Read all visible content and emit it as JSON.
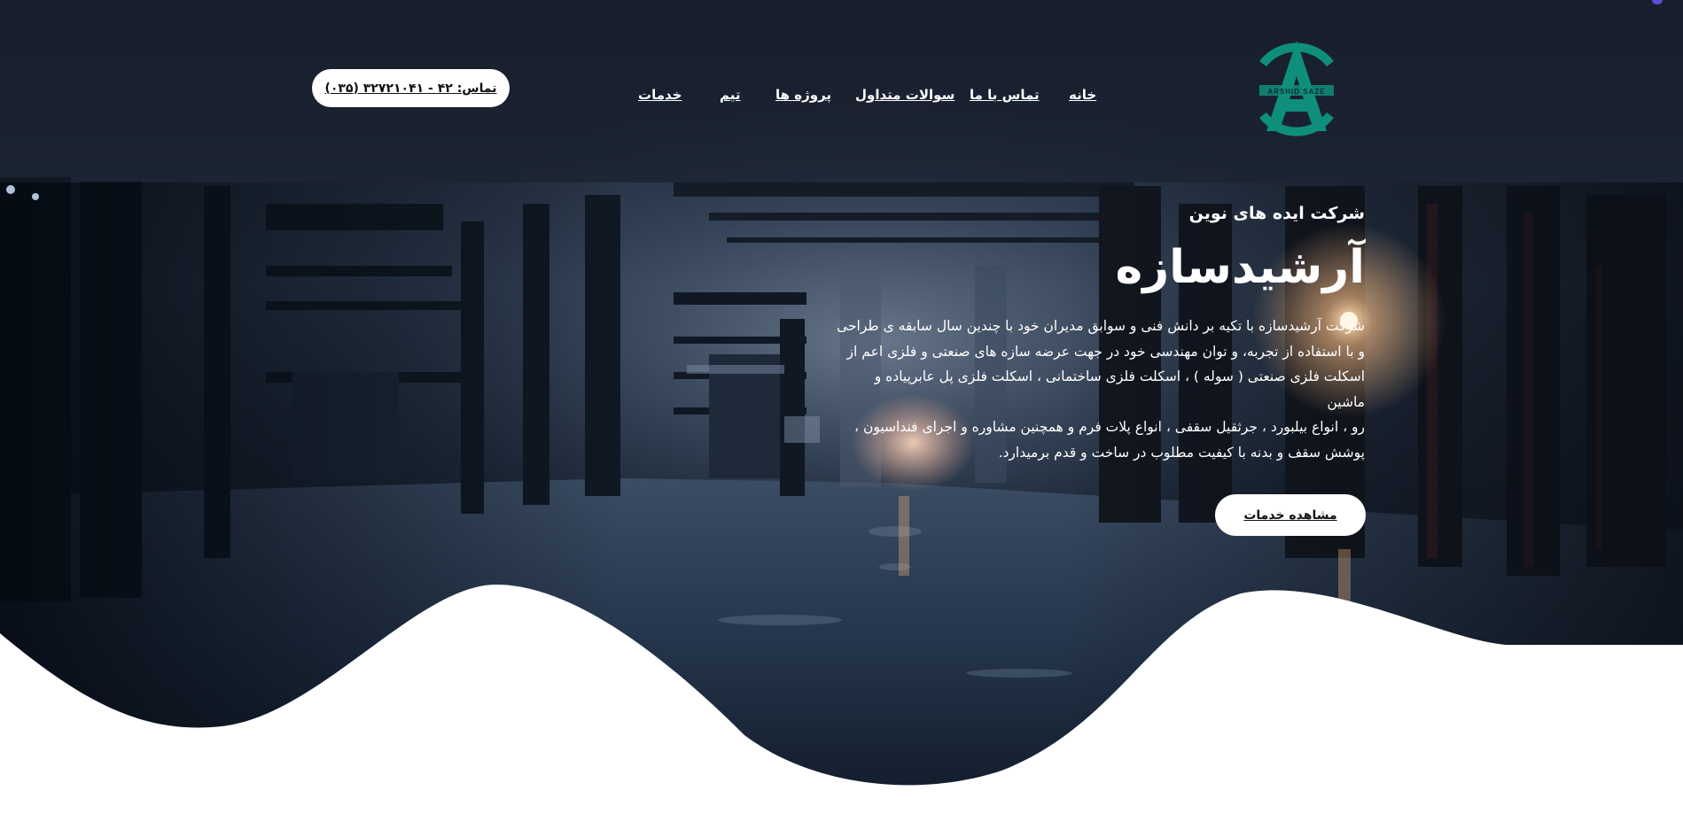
{
  "colors": {
    "brand_teal": "#0f8f7b",
    "header_overlay": "rgba(20,26,38,0.55)",
    "scene_dark": "#0c1624",
    "light_glow": "#f0b882",
    "pill_background": "#ffffff",
    "text_white": "#ffffff"
  },
  "header": {
    "logo": {
      "letters": "AS",
      "text": "ARSHID SAZE",
      "icon": "company-logo-icon"
    },
    "nav": {
      "home": "خانه",
      "contact": "تماس با ما",
      "faq": "سوالات متداول",
      "projects": "پروژه ها",
      "team": "تیم",
      "services": "خدمات"
    },
    "contact_pill": "تماس: ۴۲ - ۳۲۷۲۱۰۴۱ (۰۳۵)"
  },
  "hero": {
    "subtitle": "شرکت ایده های نوین",
    "title": "آرشیدسازه",
    "description_lines": [
      "شرکت آرشیدسازه با تکیه بر دانش فنی و سوابق مدیران خود با چندین سال سابقه ی طراحی",
      "و با استفاده از تجربه، و توان مهندسی خود در جهت عرضه سازه های صنعتی و فلزی اعم از",
      "اسکلت فلزی صنعتی ( سوله ) ، اسکلت فلزی ساختمانی ، اسکلت فلزی پل عابرپیاده و ماشین",
      "رو ، انواع بیلبورد ، جرثقیل سقفی ، انواع پلات فرم و همچنین مشاوره و اجرای فنداسیون ،",
      "پوشش سقف و بدنه با کیفیت مطلوب در ساخت و قدم برمیدارد."
    ],
    "cta": "مشاهده خدمات"
  }
}
